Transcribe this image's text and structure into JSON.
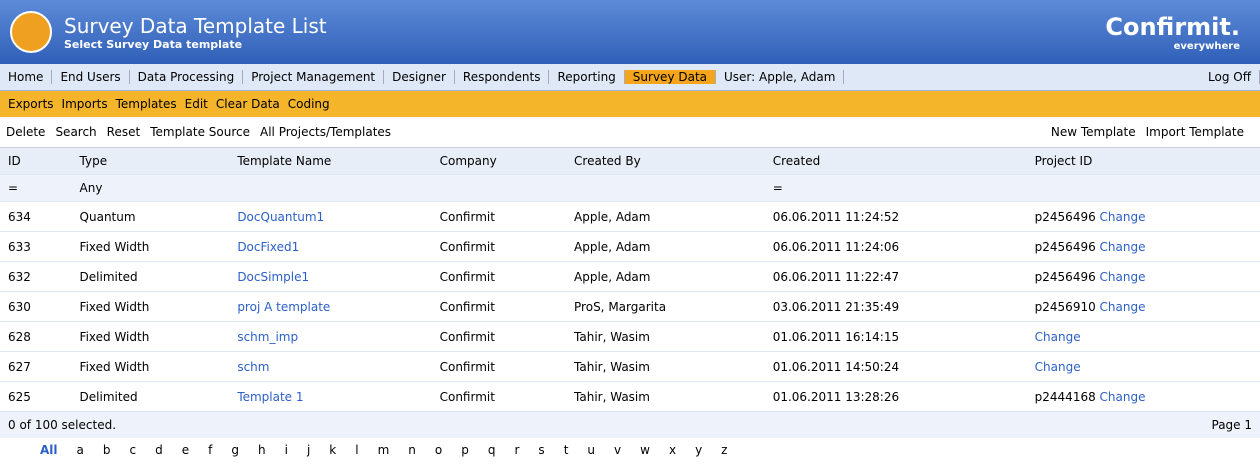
{
  "title": "Survey Data Template List",
  "subtitle": "Select Survey Data template",
  "brand": "Confirmit.",
  "tag": "everywhere",
  "nav": [
    "Home",
    "End Users",
    "Data Processing",
    "Project Management",
    "Designer",
    "Respondents",
    "Reporting",
    "Survey Data"
  ],
  "user": "User: Apple, Adam",
  "logoff": "Log Off",
  "sub": [
    "Exports",
    "Imports",
    "Templates",
    "Edit",
    "Clear Data",
    "Coding"
  ],
  "tool": {
    "delete": "Delete",
    "search": "Search",
    "reset": "Reset",
    "source_label": "Template Source",
    "source": "All Projects/Templates",
    "new": "New Template",
    "import": "Import Template"
  },
  "cols": [
    "ID",
    "Type",
    "Template Name",
    "Company",
    "Created By",
    "Created",
    "Project ID"
  ],
  "filter": {
    "op": "=",
    "type": "Any",
    "date_op": "="
  },
  "rows": [
    {
      "id": "634",
      "type": "Quantum",
      "name": "DocQuantum1",
      "company": "Confirmit",
      "by": "Apple, Adam",
      "created": "06.06.2011 11:24:52",
      "project": "p2456496",
      "action": "Change"
    },
    {
      "id": "633",
      "type": "Fixed Width",
      "name": "DocFixed1",
      "company": "Confirmit",
      "by": "Apple, Adam",
      "created": "06.06.2011 11:24:06",
      "project": "p2456496",
      "action": "Change"
    },
    {
      "id": "632",
      "type": "Delimited",
      "name": "DocSimple1",
      "company": "Confirmit",
      "by": "Apple, Adam",
      "created": "06.06.2011 11:22:47",
      "project": "p2456496",
      "action": "Change"
    },
    {
      "id": "630",
      "type": "Fixed Width",
      "name": "proj A template",
      "company": "Confirmit",
      "by": "ProS, Margarita",
      "created": "03.06.2011 21:35:49",
      "project": "p2456910",
      "action": "Change"
    },
    {
      "id": "628",
      "type": "Fixed Width",
      "name": "schm_imp",
      "company": "Confirmit",
      "by": "Tahir, Wasim",
      "created": "01.06.2011 16:14:15",
      "project": "",
      "action": "Change"
    },
    {
      "id": "627",
      "type": "Fixed Width",
      "name": "schm",
      "company": "Confirmit",
      "by": "Tahir, Wasim",
      "created": "01.06.2011 14:50:24",
      "project": "",
      "action": "Change"
    },
    {
      "id": "625",
      "type": "Delimited",
      "name": "Template 1",
      "company": "Confirmit",
      "by": "Tahir, Wasim",
      "created": "01.06.2011 13:28:26",
      "project": "p2444168",
      "action": "Change"
    }
  ],
  "status": "0 of 100 selected.",
  "page": "Page 1",
  "alpha": [
    "All",
    "a",
    "b",
    "c",
    "d",
    "e",
    "f",
    "g",
    "h",
    "i",
    "j",
    "k",
    "l",
    "m",
    "n",
    "o",
    "p",
    "q",
    "r",
    "s",
    "t",
    "u",
    "v",
    "w",
    "x",
    "y",
    "z"
  ]
}
